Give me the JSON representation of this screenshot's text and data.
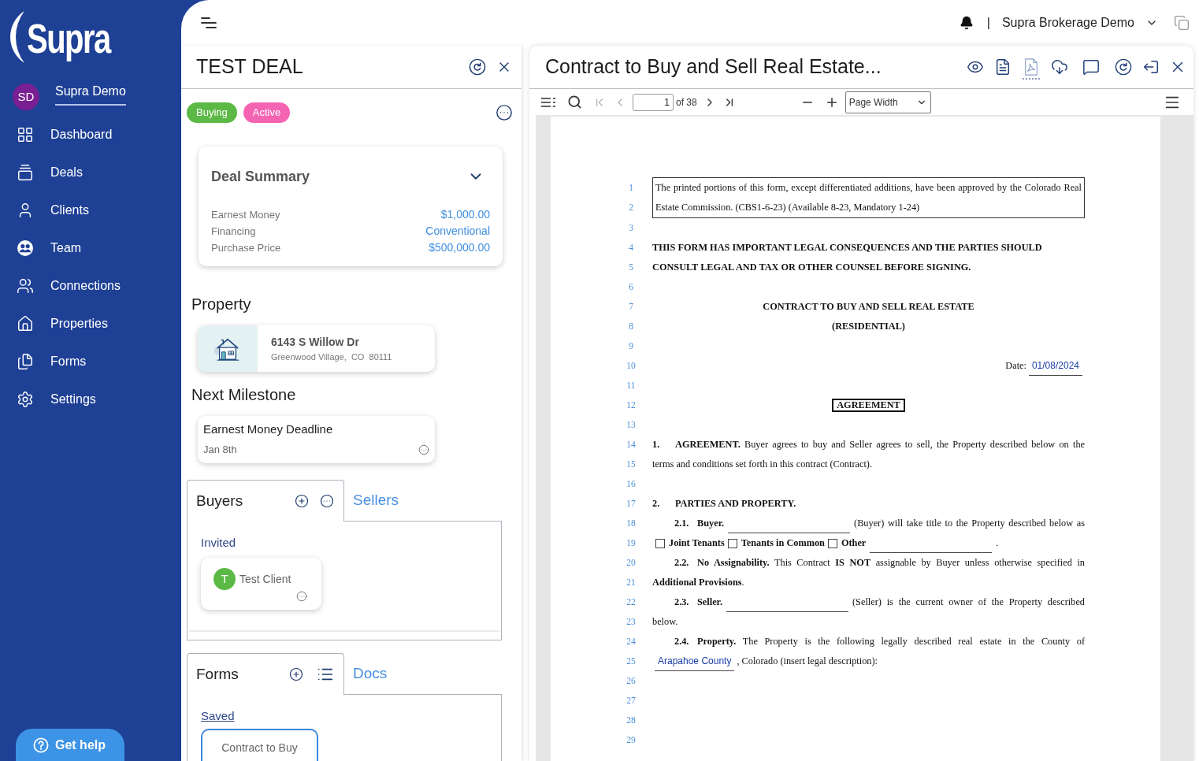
{
  "sidebar": {
    "logo": "Supra",
    "user": {
      "initials": "SD",
      "name": "Supra Demo"
    },
    "items": [
      {
        "kind": "dashboard",
        "label": "Dashboard"
      },
      {
        "kind": "deals",
        "label": "Deals"
      },
      {
        "kind": "clients",
        "label": "Clients"
      },
      {
        "kind": "team",
        "label": "Team"
      },
      {
        "kind": "connections",
        "label": "Connections"
      },
      {
        "kind": "properties",
        "label": "Properties"
      },
      {
        "kind": "forms",
        "label": "Forms"
      },
      {
        "kind": "settings",
        "label": "Settings"
      }
    ],
    "help_button": "Get help"
  },
  "topbar": {
    "separator": "|",
    "account": "Supra Brokerage Demo"
  },
  "deal": {
    "title": "TEST DEAL",
    "tags": [
      {
        "label": "Buying",
        "color": "#5cb946"
      },
      {
        "label": "Active",
        "color": "#f564b3"
      }
    ],
    "summary": {
      "title": "Deal Summary",
      "expanded": true,
      "rows": [
        {
          "label": "Earnest Money",
          "value": "$1,000.00"
        },
        {
          "label": "Financing",
          "value": "Conventional"
        },
        {
          "label": "Purchase Price",
          "value": "$500,000.00"
        }
      ]
    },
    "property_heading": "Property",
    "property": {
      "address": "6143 S Willow Dr",
      "city": "Greenwood Village,  CO  80111"
    },
    "milestone_heading": "Next Milestone",
    "milestone": {
      "title": "Earnest Money Deadline",
      "date": "Jan 8th"
    },
    "parties": {
      "tabs": [
        {
          "label": "Buyers",
          "selected": true
        },
        {
          "label": "Sellers",
          "selected": false
        }
      ],
      "group": "Invited",
      "clients": [
        {
          "initial": "T",
          "name": "Test Client"
        }
      ]
    },
    "forms": {
      "tabs": [
        {
          "label": "Forms",
          "selected": true
        },
        {
          "label": "Docs",
          "selected": false
        }
      ],
      "group": "Saved",
      "cards": [
        "Contract to Buy"
      ]
    }
  },
  "viewer": {
    "title": "Contract to Buy and Sell Real Estate...",
    "actions": [
      {
        "kind": "preview",
        "selected": false
      },
      {
        "kind": "document",
        "selected": false
      },
      {
        "kind": "pdf",
        "selected": true
      },
      {
        "kind": "download",
        "selected": false
      },
      {
        "kind": "comment",
        "selected": false
      },
      {
        "kind": "refresh",
        "selected": false
      },
      {
        "kind": "exit",
        "selected": false
      },
      {
        "kind": "close",
        "selected": false
      }
    ],
    "toolbar": {
      "nav": [
        {
          "kind": "first",
          "disabled": true
        },
        {
          "kind": "previous",
          "disabled": true
        },
        {
          "kind": "next",
          "disabled": false
        },
        {
          "kind": "last",
          "disabled": false
        }
      ],
      "page": "1",
      "page_count": "of 38",
      "zoom": "Page Width"
    },
    "document": {
      "blocks": [
        {
          "kind": "notice",
          "numbers": [
            "1",
            "2"
          ],
          "text": "The printed portions of this form, except differentiated additions, have been approved by the Colorado Real Estate Commission. (CBS1-6-23) (Available 8-23, Mandatory 1-24)"
        },
        {
          "kind": "blank",
          "number": "3"
        },
        {
          "kind": "plain",
          "number": "4",
          "segments": [
            {
              "kind": "text",
              "bold": true,
              "text": "THIS FORM HAS IMPORTANT LEGAL CONSEQUENCES AND THE PARTIES SHOULD"
            }
          ]
        },
        {
          "kind": "plain",
          "number": "5",
          "segments": [
            {
              "kind": "text",
              "bold": true,
              "text": "CONSULT LEGAL AND TAX OR OTHER COUNSEL BEFORE SIGNING."
            }
          ]
        },
        {
          "kind": "blank",
          "number": "6"
        },
        {
          "kind": "centered",
          "number": "7",
          "segments": [
            {
              "kind": "text",
              "bold": true,
              "text": "CONTRACT TO BUY AND SELL REAL ESTATE"
            }
          ]
        },
        {
          "kind": "centered",
          "number": "8",
          "segments": [
            {
              "kind": "text",
              "bold": true,
              "text": "(RESIDENTIAL)"
            }
          ]
        },
        {
          "kind": "blank",
          "number": "9"
        },
        {
          "kind": "flushright",
          "number": "10",
          "segments": [
            {
              "kind": "text",
              "text": "Date:"
            },
            {
              "kind": "field",
              "value": "01/08/2024"
            }
          ]
        },
        {
          "kind": "blank",
          "number": "11"
        },
        {
          "kind": "centered",
          "number": "12",
          "segments": [
            {
              "kind": "boxed",
              "text": "AGREEMENT"
            }
          ]
        },
        {
          "kind": "blank",
          "number": "13"
        },
        {
          "kind": "justified",
          "number": "14",
          "segments": [
            {
              "kind": "number",
              "text": "1."
            },
            {
              "kind": "text",
              "text": "**AGREEMENT.** Buyer agrees to buy and Seller agrees to sell, the Property described below on the"
            }
          ]
        },
        {
          "kind": "plain",
          "number": "15",
          "segments": [
            {
              "kind": "text",
              "text": "terms and conditions set forth in this contract (Contract)."
            }
          ]
        },
        {
          "kind": "blank",
          "number": "16"
        },
        {
          "kind": "plain",
          "number": "17",
          "segments": [
            {
              "kind": "number",
              "text": "2."
            },
            {
              "kind": "text",
              "bold": true,
              "text": "PARTIES AND PROPERTY."
            }
          ]
        },
        {
          "kind": "subclause",
          "number": "18",
          "segments": [
            {
              "kind": "number",
              "text": "2.1."
            },
            {
              "kind": "text",
              "bold": true,
              "text": "Buyer."
            },
            {
              "kind": "field"
            },
            {
              "kind": "text",
              "text": "(Buyer) will take title to the Property described below as"
            }
          ]
        },
        {
          "kind": "plain",
          "number": "19",
          "segments": [
            {
              "kind": "checkbox",
              "checked": false
            },
            {
              "kind": "text",
              "bold": true,
              "text": "Joint Tenants"
            },
            {
              "kind": "checkbox",
              "checked": false
            },
            {
              "kind": "text",
              "bold": true,
              "text": "Tenants in Common"
            },
            {
              "kind": "checkbox",
              "checked": false
            },
            {
              "kind": "text",
              "bold": true,
              "text": "Other"
            },
            {
              "kind": "field"
            },
            {
              "kind": "text",
              "text": "."
            }
          ]
        },
        {
          "kind": "subclause",
          "number": "20",
          "segments": [
            {
              "kind": "number",
              "text": "2.2."
            },
            {
              "kind": "text",
              "text": "**No Assignability.** This Contract **IS NOT** assignable by Buyer unless otherwise specified in"
            }
          ]
        },
        {
          "kind": "plain",
          "number": "21",
          "segments": [
            {
              "kind": "text",
              "text": "**Additional Provisions**."
            }
          ]
        },
        {
          "kind": "subclause",
          "number": "22",
          "segments": [
            {
              "kind": "number",
              "text": "2.3."
            },
            {
              "kind": "text",
              "bold": true,
              "text": "Seller."
            },
            {
              "kind": "field"
            },
            {
              "kind": "text",
              "text": "(Seller) is the current owner of the Property described"
            }
          ]
        },
        {
          "kind": "plain",
          "number": "23",
          "segments": [
            {
              "kind": "text",
              "text": "below."
            }
          ]
        },
        {
          "kind": "subclause",
          "number": "24",
          "segments": [
            {
              "kind": "number",
              "text": "2.4."
            },
            {
              "kind": "text",
              "text": "**Property.** The Property is the following legally described real estate in the County of"
            }
          ]
        },
        {
          "kind": "plain",
          "number": "25",
          "segments": [
            {
              "kind": "field",
              "value": "Arapahoe County"
            },
            {
              "kind": "text",
              "text": ", Colorado (insert legal description):"
            }
          ]
        },
        {
          "kind": "blank",
          "number": "26"
        },
        {
          "kind": "blank",
          "number": "27"
        },
        {
          "kind": "blank",
          "number": "28"
        },
        {
          "kind": "blank",
          "number": "29"
        }
      ]
    }
  }
}
